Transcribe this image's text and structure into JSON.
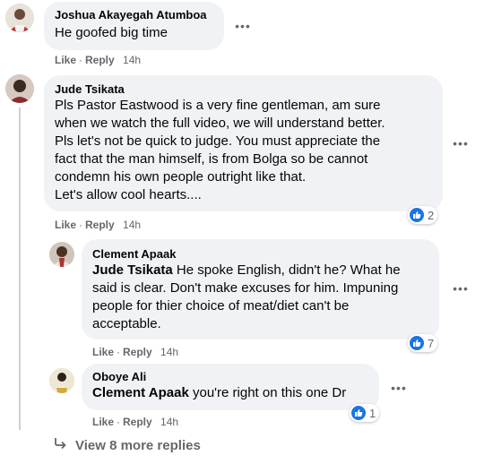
{
  "colors": {
    "bubble": "#f0f2f5",
    "meta": "#65676b",
    "like_blue": "#1b74e4",
    "text": "#050505"
  },
  "comments": [
    {
      "author": "Joshua Akayegah Atumboa",
      "text": "He goofed big time",
      "actions": {
        "like": "Like",
        "reply": "Reply",
        "time": "14h"
      }
    },
    {
      "author": "Jude Tsikata",
      "lines": [
        "Pls Pastor Eastwood is a very fine gentleman, am sure",
        "when we watch the full video, we will understand better.",
        "Pls let's not be quick to judge. You must appreciate the",
        "fact that the man himself, is from Bolga so be cannot",
        "condemn his own people outright like that.",
        "Let's allow cool hearts...."
      ],
      "actions": {
        "like": "Like",
        "reply": "Reply",
        "time": "14h"
      },
      "reaction_count": "2"
    }
  ],
  "replies": [
    {
      "author": "Clement Apaak",
      "mention": "Jude Tsikata",
      "lines": [
        " He spoke English, didn't he? What he",
        "said is clear. Don't make excuses for him. Impuning",
        "people for thier choice of meat/diet can't be",
        "acceptable."
      ],
      "actions": {
        "like": "Like",
        "reply": "Reply",
        "time": "14h"
      },
      "reaction_count": "7"
    },
    {
      "author": "Oboye Ali",
      "mention": "Clement Apaak",
      "text": " you're right on this one Dr",
      "actions": {
        "like": "Like",
        "reply": "Reply",
        "time": "14h"
      },
      "reaction_count": "1"
    }
  ],
  "view_more": "View 8 more replies",
  "more_icon": "more-horizontal-icon"
}
